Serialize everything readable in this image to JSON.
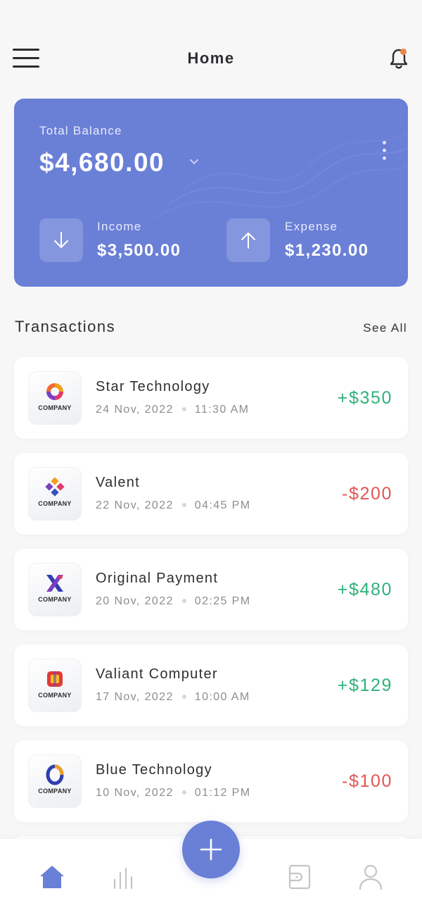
{
  "header": {
    "title": "Home",
    "notification_dot_color": "#e8894a"
  },
  "balance": {
    "label": "Total Balance",
    "amount": "$4,680.00",
    "card_color": "#6a7fd6",
    "income": {
      "label": "Income",
      "amount": "$3,500.00"
    },
    "expense": {
      "label": "Expense",
      "amount": "$1,230.00"
    }
  },
  "transactions": {
    "title": "Transactions",
    "see_all": "See All",
    "items": [
      {
        "name": "Star Technology",
        "date": "24 Nov, 2022",
        "time": "11:30 AM",
        "amount": "+$350",
        "type": "income",
        "logo_text": "COMPANY",
        "logo": "swirl-logo-icon"
      },
      {
        "name": "Valent",
        "date": "22 Nov, 2022",
        "time": "04:45 PM",
        "amount": "-$200",
        "type": "expense",
        "logo_text": "COMPANY",
        "logo": "diamond-logo-icon"
      },
      {
        "name": "Original Payment",
        "date": "20 Nov, 2022",
        "time": "02:25 PM",
        "amount": "+$480",
        "type": "income",
        "logo_text": "COMPANY",
        "logo": "x-logo-icon"
      },
      {
        "name": "Valiant Computer",
        "date": "17 Nov, 2022",
        "time": "10:00 AM",
        "amount": "+$129",
        "type": "income",
        "logo_text": "COMPANY",
        "logo": "square-logo-icon"
      },
      {
        "name": "Blue Technology",
        "date": "10 Nov, 2022",
        "time": "01:12 PM",
        "amount": "-$100",
        "type": "expense",
        "logo_text": "COMPANY",
        "logo": "ring-logo-icon"
      }
    ]
  },
  "colors": {
    "income": "#2fb27a",
    "expense": "#e25555",
    "accent": "#6a7fd6"
  },
  "nav": {
    "items": [
      "home-icon",
      "stats-icon",
      "add-icon",
      "wallet-icon",
      "profile-icon"
    ],
    "active": "home-icon"
  }
}
